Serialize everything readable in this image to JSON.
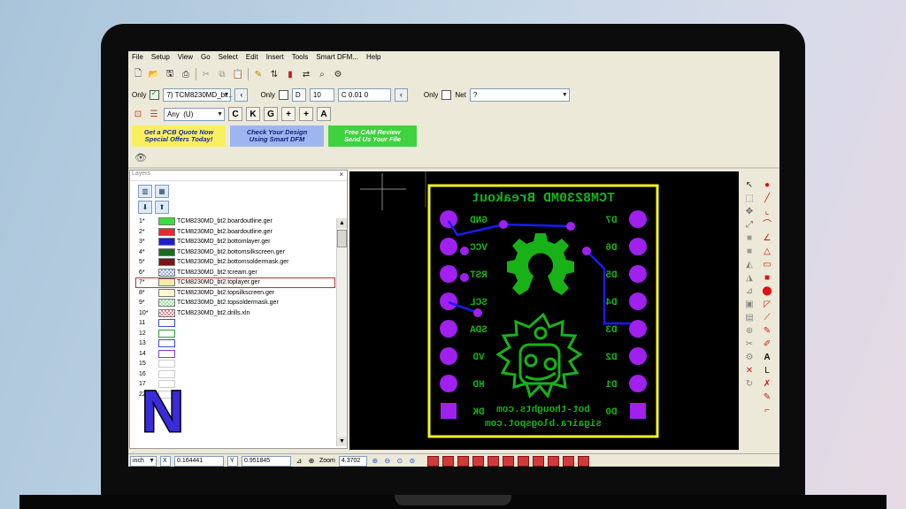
{
  "menu": [
    "File",
    "Setup",
    "View",
    "Go",
    "Select",
    "Edit",
    "Insert",
    "Tools",
    "Smart DFM...",
    "Help"
  ],
  "toolbar1_icons": [
    "new-file-icon",
    "open-folder-icon",
    "save-icon",
    "print-icon",
    "cut-icon",
    "copy-icon",
    "paste-icon",
    "draw-icon",
    "measure-icon",
    "layer-icon",
    "flip-icon",
    "zoom-icon",
    "dfm-icon"
  ],
  "row2": {
    "only_label": "Only",
    "layer_value": "7) TCM8230MD_bt...",
    "d_label": "D",
    "d_value": "10",
    "c_value": "C 0.01  0",
    "only_label2": "Only",
    "net_label": "Net",
    "net_value": "?"
  },
  "row3": {
    "any_value": "Any",
    "u_value": "(U)",
    "letters": [
      "C",
      "K",
      "G",
      "+",
      "+",
      "A"
    ]
  },
  "ads": {
    "ad1": [
      "Get a PCB Quote Now",
      "Special Offers Today!"
    ],
    "ad2": [
      "Check Your Design",
      "Using Smart DFM"
    ],
    "ad3": [
      "Free CAM Review",
      "Send Us Your File"
    ]
  },
  "layers": {
    "header": "Layers",
    "close": "×",
    "items": [
      {
        "num": "1*",
        "name": "TCM8230MD_bt2.boardoutline.ger",
        "color": "#39e039",
        "pattern": "solid"
      },
      {
        "num": "2*",
        "name": "TCM8230MD_bt2.boardoutline.ger",
        "color": "#ea2a2a",
        "pattern": "solid"
      },
      {
        "num": "3*",
        "name": "TCM8230MD_bt2.bottomlayer.ger",
        "color": "#1f1fcf",
        "pattern": "solid"
      },
      {
        "num": "4*",
        "name": "TCM8230MD_bt2.bottomsilkscreen.ger",
        "color": "#1d6b1d",
        "pattern": "solid"
      },
      {
        "num": "5*",
        "name": "TCM8230MD_bt2.bottomsoldermask.ger",
        "color": "#7a1515",
        "pattern": "solid"
      },
      {
        "num": "6*",
        "name": "TCM8230MD_bt2.tcream.ger",
        "color": "#8fa8e8",
        "pattern": "check"
      },
      {
        "num": "7*",
        "name": "TCM8230MD_bt2.toplayer.ger",
        "color": "#fde9a8",
        "pattern": "solid",
        "selected": true
      },
      {
        "num": "8*",
        "name": "TCM8230MD_bt2.topsilkscreen.ger",
        "color": "#fff8c8",
        "pattern": "solid"
      },
      {
        "num": "9*",
        "name": "TCM8230MD_bt2.topsoldermask.ger",
        "color": "#9ae29a",
        "pattern": "check"
      },
      {
        "num": "10*",
        "name": "TCM8230MD_bt2.drills.xln",
        "color": "#e88a8a",
        "pattern": "check"
      },
      {
        "num": "11",
        "name": "",
        "color": "#ffffff",
        "pattern": "blue-border"
      },
      {
        "num": "12",
        "name": "",
        "color": "#ffffff",
        "pattern": "green-border"
      },
      {
        "num": "13",
        "name": "",
        "color": "#ffffff",
        "pattern": "blue-border"
      },
      {
        "num": "14",
        "name": "",
        "color": "#ffffff",
        "pattern": "purple-border"
      },
      {
        "num": "15",
        "name": "",
        "color": "#ffffff",
        "pattern": "plain"
      },
      {
        "num": "16",
        "name": "",
        "color": "#ffffff",
        "pattern": "plain"
      },
      {
        "num": "17",
        "name": "",
        "color": "#ffffff",
        "pattern": "plain"
      },
      {
        "num": "22",
        "name": "",
        "color": "#ffffff",
        "pattern": "plain"
      }
    ]
  },
  "board": {
    "title": "TCM8230MD Breakout",
    "left_pins": [
      "GND",
      "VCC",
      "RST",
      "SCL",
      "SDA",
      "VD",
      "HD",
      "DK"
    ],
    "right_pins": [
      "D7",
      "D6",
      "D5",
      "D4",
      "D3",
      "D2",
      "D1",
      "D0"
    ],
    "footer1": "bot-thoughts.com",
    "footer2": "sigaira.blogspot.com",
    "colors": {
      "outline": "#f5f51e",
      "pad": "#a020f0",
      "silk": "#18b218",
      "trace": "#1a1aff"
    }
  },
  "status": {
    "unit": "inch",
    "x_label": "X",
    "x_value": "0.164441",
    "y_label": "Y",
    "y_value": "0.951845",
    "zoom_label": "Zoom",
    "zoom_value": "4.3702"
  },
  "right_tool_icons": [
    "pointer-icon",
    "red-dot-icon",
    "line-icon",
    "arc-icon",
    "angle-icon",
    "triangle-icon",
    "rect-icon",
    "circle-icon",
    "polygon-icon",
    "text-icon",
    "dimension-icon",
    "delete-icon",
    "gear-icon"
  ],
  "logo_letter": "N"
}
